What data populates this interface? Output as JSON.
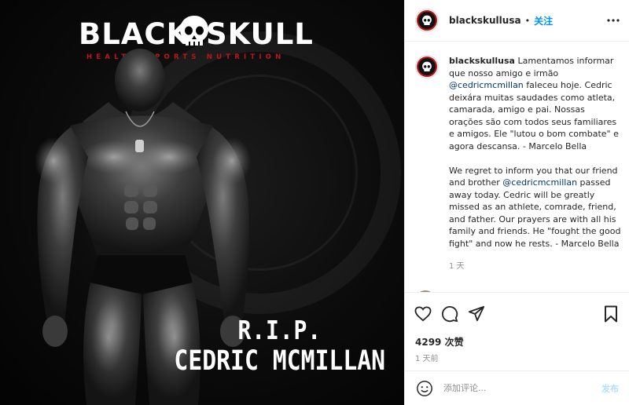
{
  "media": {
    "brand_left": "BLACK",
    "brand_right": "SKULL",
    "brand_tagline": "HEALTH SPORTS NUTRITION",
    "rip": "R.I.P.",
    "name": "CEDRIC MCMILLAN",
    "accent": "#c0141b"
  },
  "header": {
    "username": "blackskullusa",
    "separator": "•",
    "follow_label": "关注",
    "more_icon": "more-horizontal-icon"
  },
  "caption": {
    "username": "blackskullusa",
    "pt_before_mention": "Lamentamos informar que nosso amigo e irmão ",
    "pt_mention": "@cedricmcmillan",
    "pt_after_mention": " faleceu hoje. Cedric deixára muitas saudades como atleta, camarada, amigo e pai. Nossas orações são com todos seus familiares e amigos. Ele \"lutou o bom combate\" e agora descansa. - Marcelo Bella",
    "en_before_mention": "We regret to inform you that our friend and brother ",
    "en_mention": "@cedricmcmillan",
    "en_after_mention": " passed away today. Cedric will be greatly missed as an athlete, comrade, friend, and father. Our prayers are with all his family and friends. He \"fought the good fight\" and now he rests. - Marcelo Bella",
    "time": "1 天"
  },
  "actions": {
    "like_icon": "heart-icon",
    "comment_icon": "comment-icon",
    "share_icon": "share-icon",
    "save_icon": "bookmark-icon"
  },
  "likes": "4299 次赞",
  "post_time": "1 天前",
  "comment_box": {
    "emoji_icon": "emoji-icon",
    "placeholder": "添加评论...",
    "post_label": "发布",
    "post_color": "#b2dffc"
  },
  "colors": {
    "link": "#0095f6",
    "mention": "#00376b",
    "muted": "#8e8e8e",
    "border": "#efefef"
  }
}
